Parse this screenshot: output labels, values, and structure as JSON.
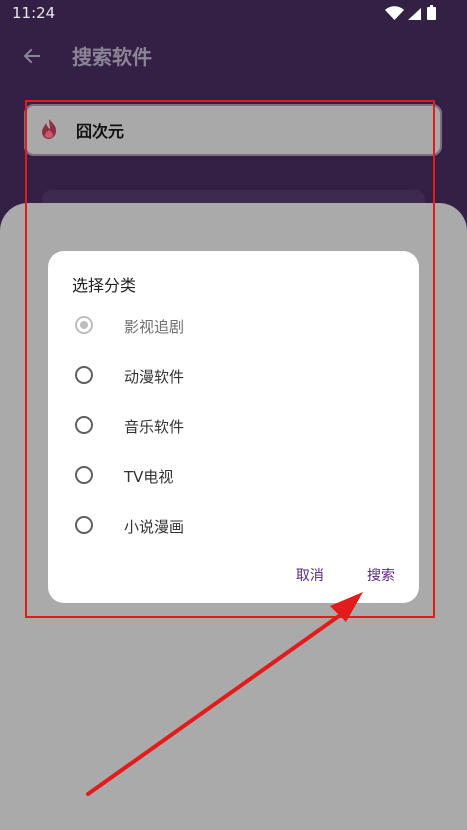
{
  "status": {
    "time": "11:24"
  },
  "app_bar": {
    "title": "搜索软件"
  },
  "search": {
    "value": "囧次元"
  },
  "dialog": {
    "title": "选择分类",
    "options": [
      {
        "label": "影视追剧",
        "checked": true
      },
      {
        "label": "动漫软件",
        "checked": false
      },
      {
        "label": "音乐软件",
        "checked": false
      },
      {
        "label": "TV电视",
        "checked": false
      },
      {
        "label": "小说漫画",
        "checked": false
      }
    ],
    "cancel_label": "取消",
    "search_label": "搜索"
  },
  "colors": {
    "top_bar": "#342045",
    "dialog_action": "#5b2a82",
    "annotation_red": "#e21b1b"
  },
  "icons": {
    "back": "back-arrow-icon",
    "flame": "flame-icon",
    "wifi": "wifi-icon",
    "signal": "signal-icon",
    "battery": "battery-icon"
  }
}
